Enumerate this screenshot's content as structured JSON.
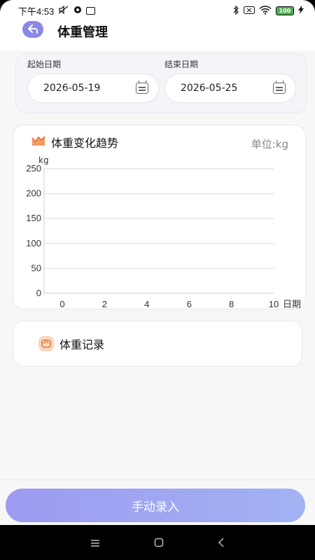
{
  "status_bar": {
    "time": "下午4:53",
    "battery": "100"
  },
  "header": {
    "title": "体重管理"
  },
  "date_range": {
    "start_label": "起始日期",
    "start_value": "2026-05-19",
    "end_label": "结束日期",
    "end_value": "2026-05-25"
  },
  "chart_card": {
    "title": "体重变化趋势",
    "unit_label": "单位:kg"
  },
  "chart_data": {
    "type": "line",
    "title": "",
    "ylabel": "kg",
    "xlabel": "日期",
    "ylim": [
      0,
      250
    ],
    "xlim": [
      0,
      10
    ],
    "y_ticks": [
      "0",
      "50",
      "100",
      "150",
      "200",
      "250"
    ],
    "x_ticks": [
      "0",
      "2",
      "4",
      "6",
      "8",
      "10"
    ],
    "series": [],
    "grid": true
  },
  "record_card": {
    "title": "体重记录"
  },
  "actions": {
    "submit_label": "手动录入"
  },
  "colors": {
    "accent": "#8b87e8",
    "button_gradient_start": "#8e8aef",
    "button_gradient_end": "#94a7f2",
    "chart_icon": "#f08a4b"
  }
}
